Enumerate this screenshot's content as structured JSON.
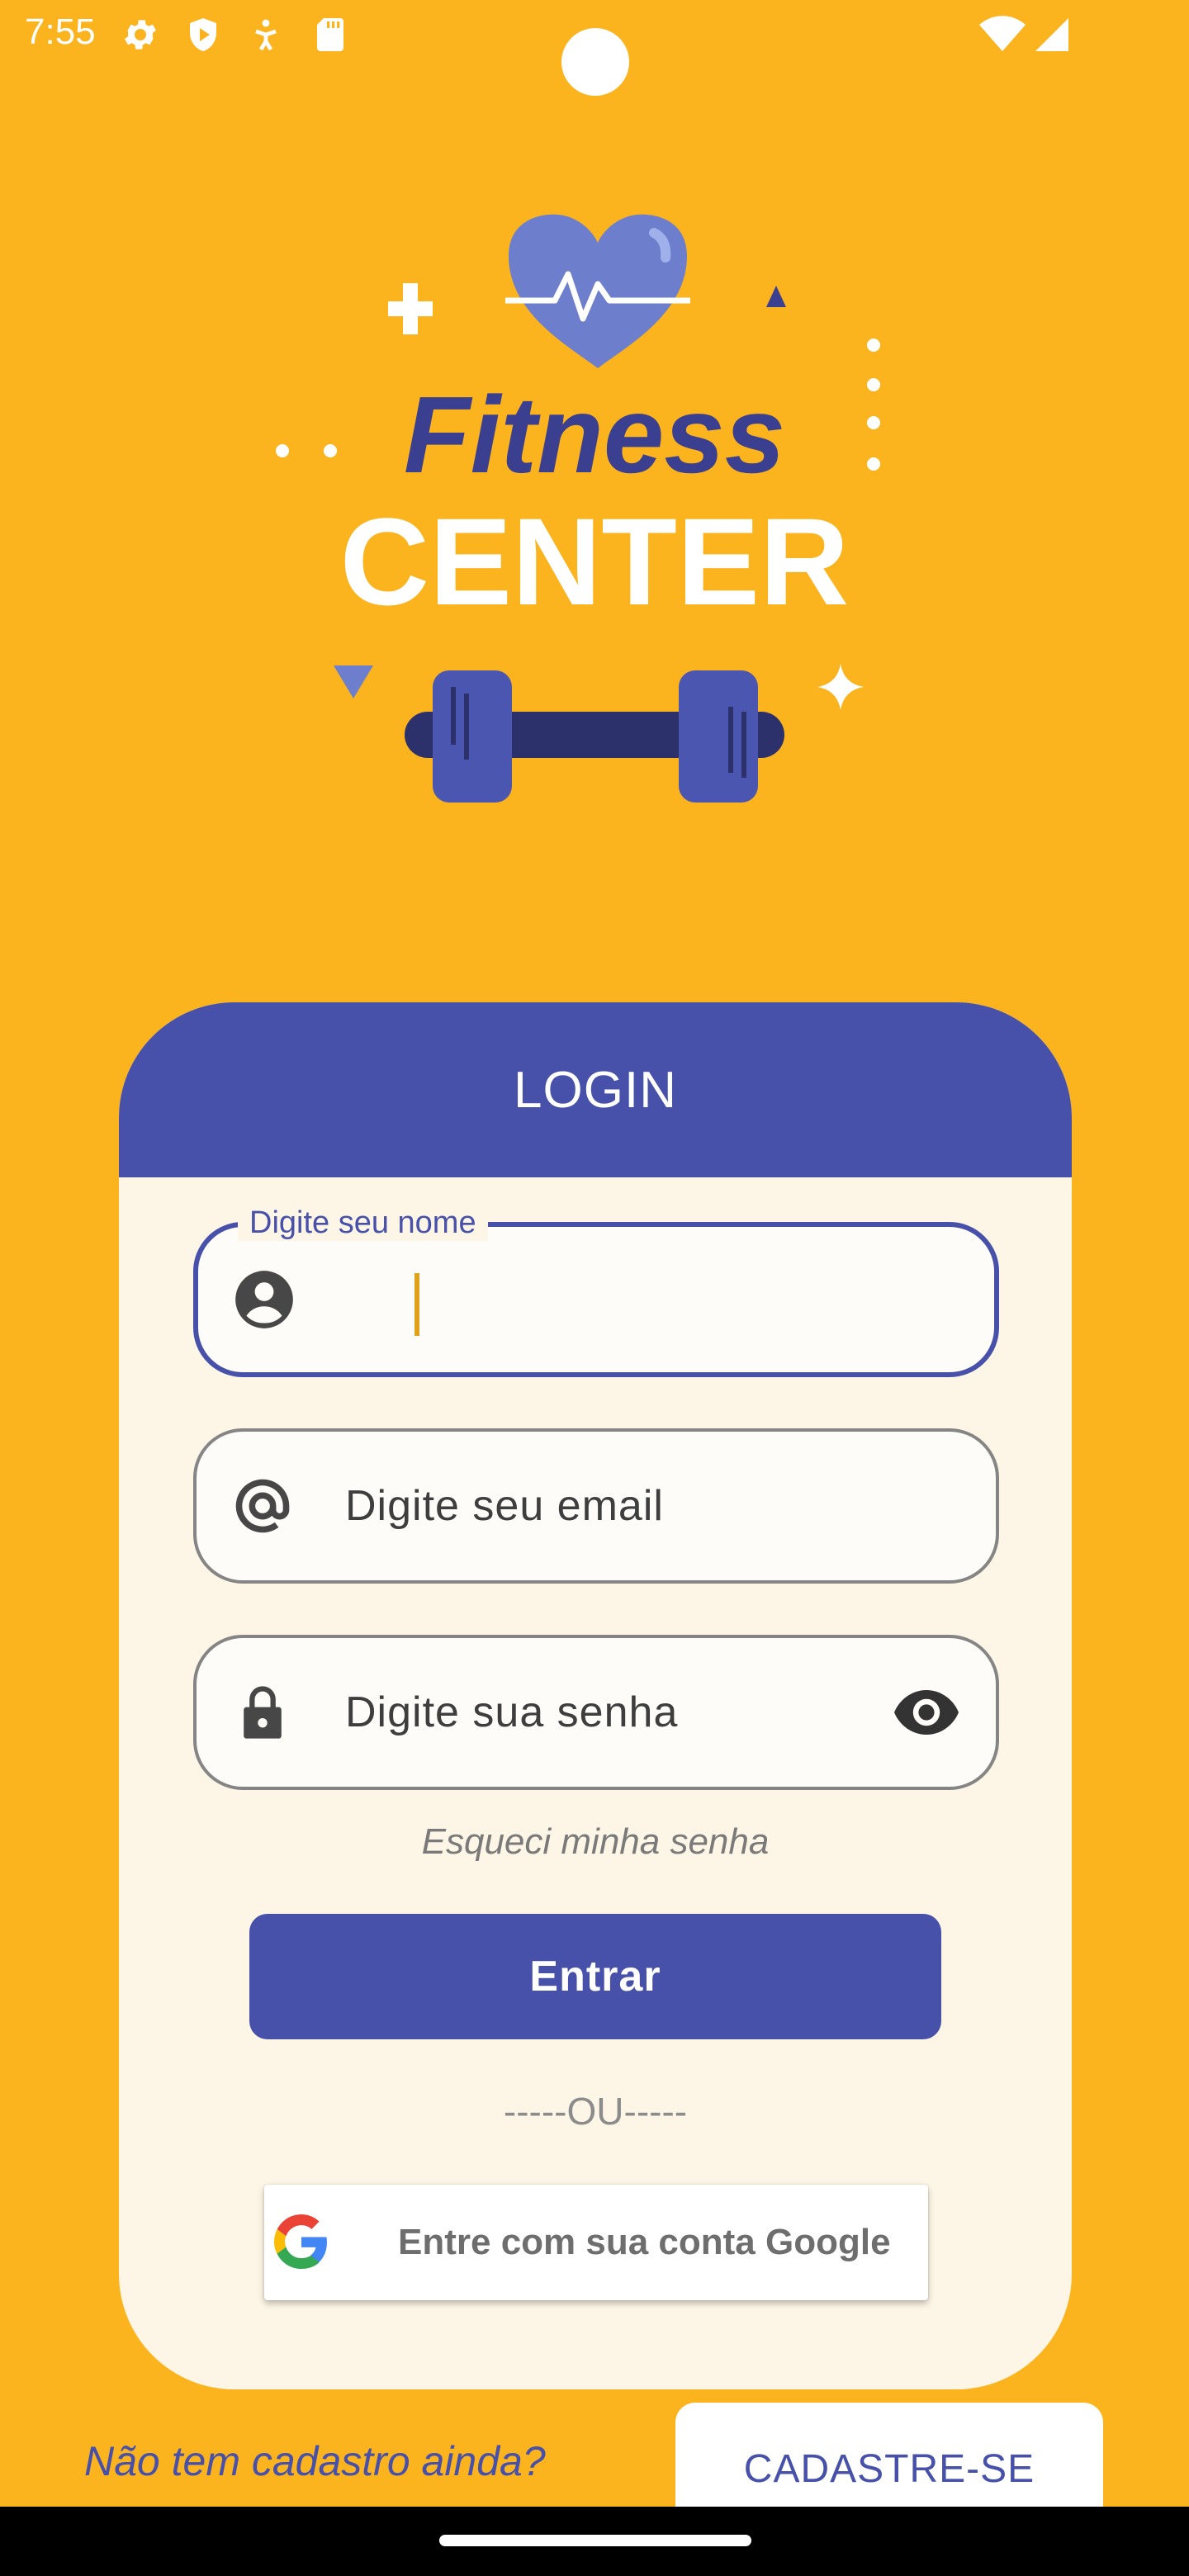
{
  "status_bar": {
    "time": "7:55",
    "icons": [
      "gear-icon",
      "shield-icon",
      "accessibility-icon",
      "sd-card-icon"
    ],
    "right_icons": [
      "wifi-icon",
      "signal-icon"
    ]
  },
  "logo": {
    "line1": "Fitness",
    "line2": "CENTER",
    "colors": {
      "heart": "#6D7FCC",
      "fitness": "#3A3F8F",
      "dumbbell": "#4B56B0",
      "bar": "#2C306B"
    }
  },
  "login": {
    "title": "LOGIN",
    "name_field": {
      "label": "Digite seu nome",
      "value": ""
    },
    "email_field": {
      "placeholder": "Digite seu email"
    },
    "password_field": {
      "placeholder": "Digite sua senha"
    },
    "forgot_label": "Esqueci minha senha",
    "enter_label": "Entrar",
    "separator": "-----OU-----",
    "google_label": "Entre com sua conta Google"
  },
  "footer": {
    "no_account": "Não tem cadastro ainda?",
    "register_label": "CADASTRE-SE"
  },
  "colors": {
    "background": "#FBB31E",
    "primary": "#4751AA",
    "card": "#FDF5E5"
  }
}
